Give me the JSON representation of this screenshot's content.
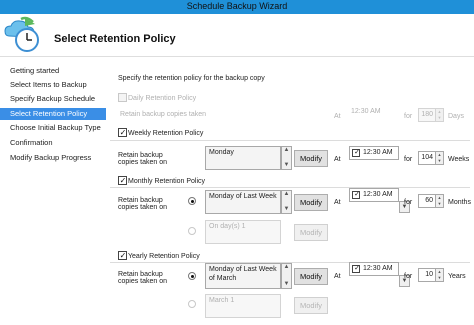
{
  "window": {
    "title": "Schedule Backup Wizard"
  },
  "header": {
    "title": "Select Retention Policy",
    "icon": "backup-clock-icon"
  },
  "nav": {
    "items": [
      {
        "label": "Getting started"
      },
      {
        "label": "Select Items to Backup"
      },
      {
        "label": "Specify Backup Schedule"
      },
      {
        "label": "Select Retention Policy"
      },
      {
        "label": "Choose Initial Backup Type"
      },
      {
        "label": "Confirmation"
      },
      {
        "label": "Modify Backup Progress"
      }
    ]
  },
  "main": {
    "intro": "Specify the retention policy for the backup copy",
    "daily": {
      "label": "Daily Retention Policy",
      "checked": false,
      "retain_label": "Retain backup copies taken",
      "at_label": "At",
      "time": "12:30 AM",
      "for_label": "for",
      "count": "180",
      "unit": "Days"
    },
    "weekly": {
      "label": "Weekly Retention Policy",
      "checked": true,
      "retain_label_1": "Retain backup",
      "retain_label_2": "copies taken on",
      "value": "Monday",
      "modify": "Modify",
      "at_label": "At",
      "time": "12:30 AM",
      "for_label": "for",
      "count": "104",
      "unit": "Weeks"
    },
    "monthly": {
      "label": "Monthly Retention Policy",
      "checked": true,
      "retain_label_1": "Retain backup",
      "retain_label_2": "copies taken on",
      "value": "Monday of Last Week",
      "modify": "Modify",
      "alt_value": "On day(s) 1",
      "alt_modify": "Modify",
      "at_label": "At",
      "time": "12:30 AM",
      "for_label": "for",
      "count": "60",
      "unit": "Months"
    },
    "yearly": {
      "label": "Yearly Retention Policy",
      "checked": true,
      "retain_label_1": "Retain backup",
      "retain_label_2": "copies taken on",
      "value_1": "Monday of Last Week",
      "value_2": "of March",
      "modify": "Modify",
      "alt_value": "March 1",
      "alt_modify": "Modify",
      "at_label": "At",
      "time": "12:30 AM",
      "for_label": "for",
      "count": "10",
      "unit": "Years"
    },
    "check_mark": "✓"
  }
}
